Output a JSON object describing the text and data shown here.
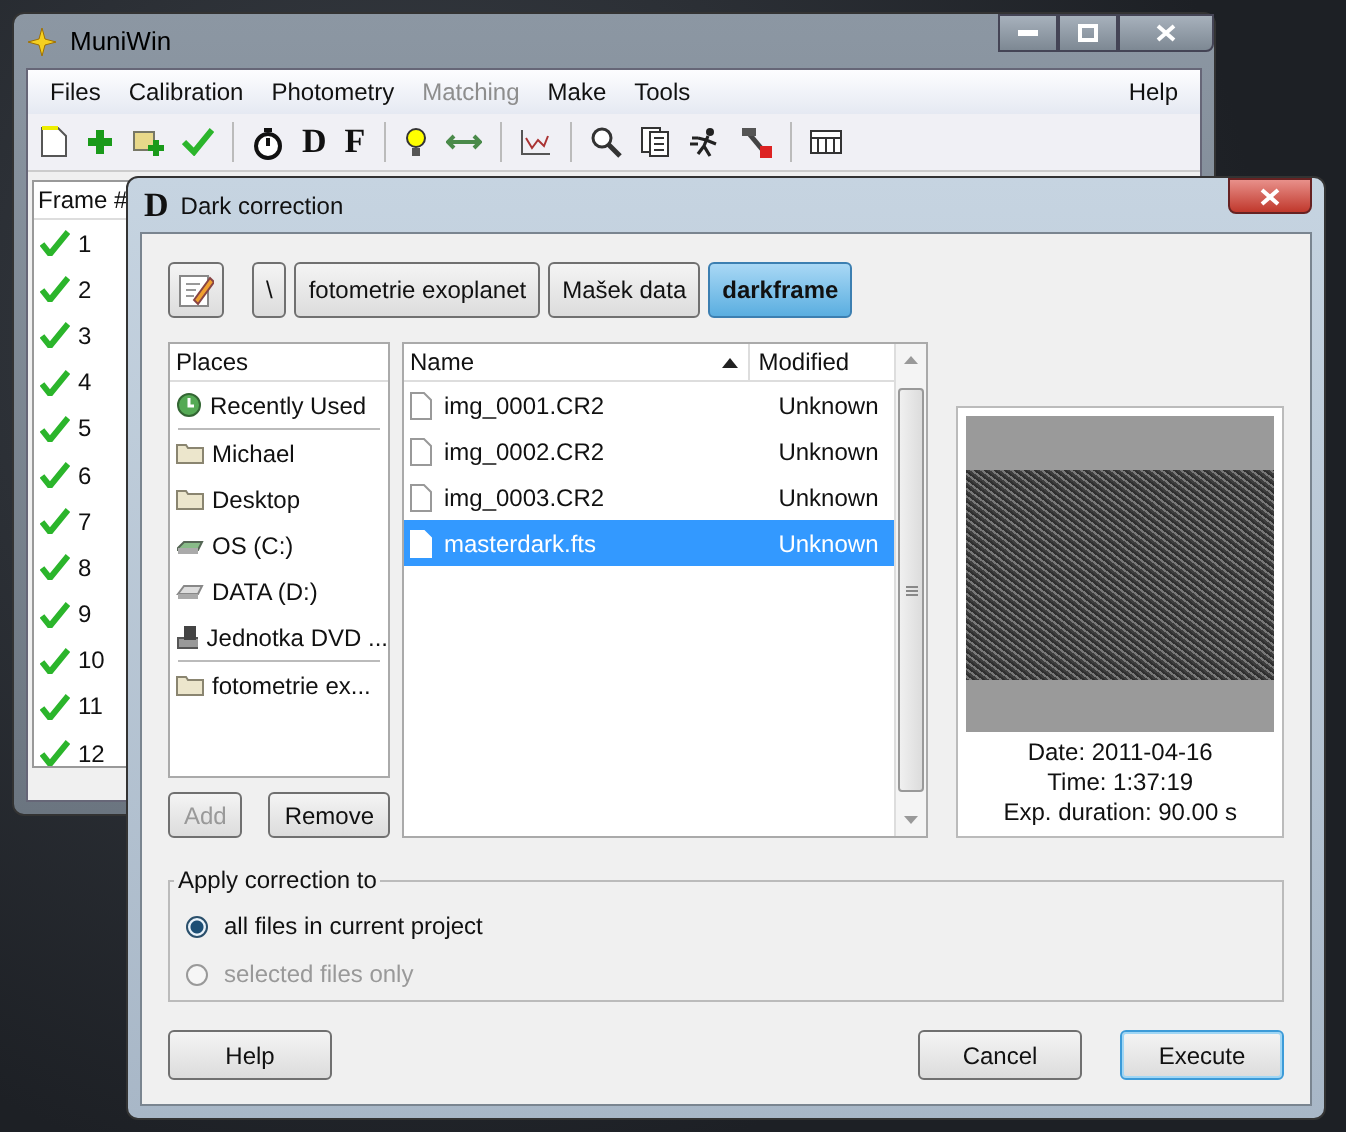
{
  "main_window": {
    "title": "MuniWin",
    "menu": [
      {
        "label": "Files",
        "disabled": false
      },
      {
        "label": "Calibration",
        "disabled": false
      },
      {
        "label": "Photometry",
        "disabled": false
      },
      {
        "label": "Matching",
        "disabled": true
      },
      {
        "label": "Make",
        "disabled": false
      },
      {
        "label": "Tools",
        "disabled": false
      }
    ],
    "help_menu": "Help",
    "toolbar_letters": [
      "D",
      "F"
    ],
    "frames": {
      "header": "Frame #",
      "rows": [
        {
          "label": "1",
          "done": true
        },
        {
          "label": "2",
          "done": true
        },
        {
          "label": "3",
          "done": true
        },
        {
          "label": "4",
          "done": true
        },
        {
          "label": "5",
          "done": true
        },
        {
          "label": "6",
          "done": true
        },
        {
          "label": "7",
          "done": true
        },
        {
          "label": "8",
          "done": true
        },
        {
          "label": "9",
          "done": true
        },
        {
          "label": "10",
          "done": true
        },
        {
          "label": "11",
          "done": true
        },
        {
          "label": "12",
          "done": true
        }
      ]
    }
  },
  "dialog": {
    "title_icon": "D",
    "title": "Dark correction",
    "path": [
      {
        "label": "\\",
        "selected": false
      },
      {
        "label": "fotometrie exoplanet",
        "selected": false
      },
      {
        "label": "Mašek data",
        "selected": false
      },
      {
        "label": "darkframe",
        "selected": true
      }
    ],
    "places": {
      "header": "Places",
      "groups": [
        [
          {
            "label": "Recently Used",
            "kind": "recent"
          }
        ],
        [
          {
            "label": "Michael",
            "kind": "folder"
          },
          {
            "label": "Desktop",
            "kind": "folder"
          },
          {
            "label": "OS (C:)",
            "kind": "system-drive"
          },
          {
            "label": "DATA (D:)",
            "kind": "drive"
          },
          {
            "label": "Jednotka DVD ...",
            "kind": "dvd"
          }
        ],
        [
          {
            "label": "fotometrie ex...",
            "kind": "folder"
          }
        ]
      ]
    },
    "place_buttons": [
      {
        "label": "Add",
        "disabled": true
      },
      {
        "label": "Remove",
        "disabled": false
      }
    ],
    "files": {
      "columns": [
        "Name",
        "Modified"
      ],
      "rows": [
        {
          "name": "img_0001.CR2",
          "modified": "Unknown",
          "selected": false
        },
        {
          "name": "img_0002.CR2",
          "modified": "Unknown",
          "selected": false
        },
        {
          "name": "img_0003.CR2",
          "modified": "Unknown",
          "selected": false
        },
        {
          "name": "masterdark.fts",
          "modified": "Unknown",
          "selected": true
        }
      ]
    },
    "preview": {
      "lines": [
        "Date: 2011-04-16",
        "Time: 1:37:19",
        "Exp. duration: 90.00 s"
      ]
    },
    "apply": {
      "legend": "Apply correction to",
      "options": [
        {
          "label": "all files in current project",
          "selected": true,
          "disabled": false
        },
        {
          "label": "selected files only",
          "selected": false,
          "disabled": true
        }
      ]
    },
    "buttons": [
      {
        "label": "Help",
        "default": false
      },
      {
        "label": "Cancel",
        "default": false
      },
      {
        "label": "Execute",
        "default": true
      }
    ]
  }
}
